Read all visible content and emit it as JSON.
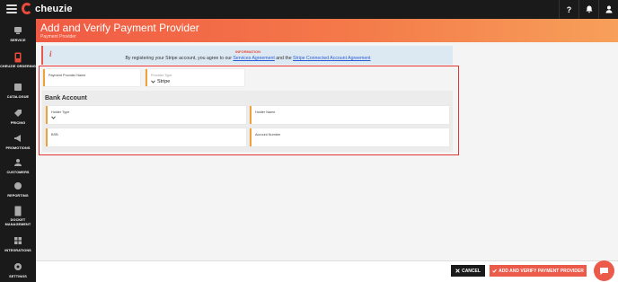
{
  "app": {
    "logo_text": "cheuzie"
  },
  "topbar": {
    "help_label": "?"
  },
  "sidebar": {
    "items": [
      {
        "label": "SERVICE"
      },
      {
        "label": "CHEUZIE ORDERING"
      },
      {
        "label": "CATALOGUE"
      },
      {
        "label": "PRICING"
      },
      {
        "label": "PROMOTIONS"
      },
      {
        "label": "CUSTOMERS"
      },
      {
        "label": "REPORTING"
      },
      {
        "label": "DOCKET MANAGEMENT"
      },
      {
        "label": "INTEGRATIONS"
      },
      {
        "label": "SETTINGS"
      }
    ]
  },
  "header": {
    "title": "Add and Verify Payment Provider",
    "breadcrumb": "Payment Provider"
  },
  "info": {
    "heading": "INFORMATION",
    "text_before": "By registering your Stripe account, you agree to our ",
    "link1": "Services Agreement",
    "text_middle": " and the ",
    "link2": "Stripe Connected Account Agreement"
  },
  "form": {
    "payment_provider_name": {
      "label": "Payment Provider Name",
      "value": ""
    },
    "provider_type": {
      "label": "Provider Type",
      "value": "Stripe"
    },
    "bank_section_title": "Bank Account",
    "holder_type": {
      "label": "Holder Type",
      "value": ""
    },
    "holder_name": {
      "label": "Holder Name",
      "value": ""
    },
    "bsb": {
      "label": "BSB",
      "value": ""
    },
    "account_number": {
      "label": "Account Number",
      "value": ""
    }
  },
  "actions": {
    "cancel_label": "CANCEL",
    "submit_label": "ADD AND VERIFY PAYMENT PROVIDER"
  },
  "colors": {
    "accent": "#ec5a4a",
    "field_border": "#f0a23a",
    "highlight": "#e63535"
  }
}
